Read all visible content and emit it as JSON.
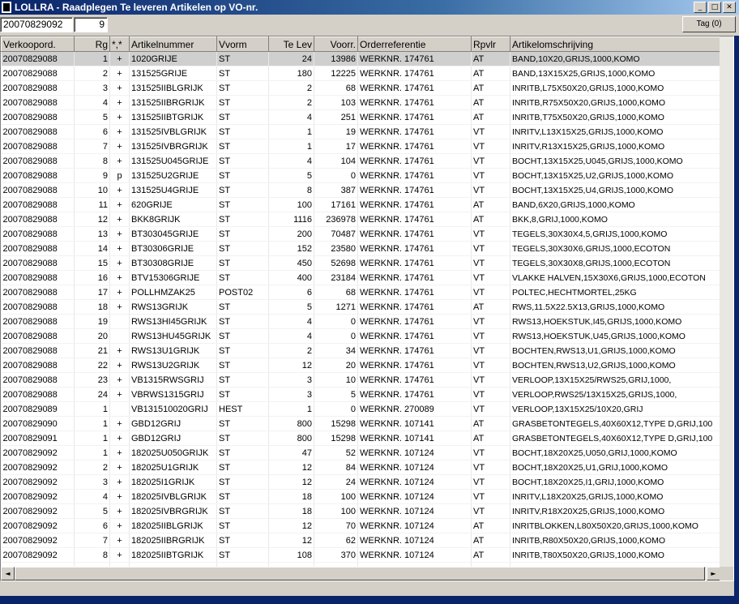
{
  "window": {
    "title": "LOLLRA - Raadplegen Te leveren Artikelen op VO-nr.",
    "minimize_glyph": "_",
    "maximize_glyph": "□",
    "close_glyph": "✕"
  },
  "toolbar": {
    "order_value": "20070829092",
    "count_value": "9",
    "tag_button_label": "Tag (0)"
  },
  "columns": [
    "Verkoopord.",
    "Rg",
    "*,*",
    "Artikelnummer",
    "Vvorm",
    "Te Lev",
    "Voorr.",
    "Orderreferentie",
    "Rpvlr",
    "Artikelomschrijving"
  ],
  "rows": [
    {
      "vo": "20070829088",
      "rg": "1",
      "flag": "+",
      "art": "1020GRIJE",
      "vvorm": "ST",
      "telev": "24",
      "voorr": "13986",
      "ref": "WERKNR. 174761",
      "rpvlr": "AT",
      "desc": "BAND,10X20,GRIJS,1000,KOMO",
      "selected": true
    },
    {
      "vo": "20070829088",
      "rg": "2",
      "flag": "+",
      "art": "131525GRIJE",
      "vvorm": "ST",
      "telev": "180",
      "voorr": "12225",
      "ref": "WERKNR. 174761",
      "rpvlr": "AT",
      "desc": "BAND,13X15X25,GRIJS,1000,KOMO"
    },
    {
      "vo": "20070829088",
      "rg": "3",
      "flag": "+",
      "art": "131525IIBLGRIJK",
      "vvorm": "ST",
      "telev": "2",
      "voorr": "68",
      "ref": "WERKNR. 174761",
      "rpvlr": "AT",
      "desc": "INRITB,L75X50X20,GRIJS,1000,KOMO"
    },
    {
      "vo": "20070829088",
      "rg": "4",
      "flag": "+",
      "art": "131525IIBRGRIJK",
      "vvorm": "ST",
      "telev": "2",
      "voorr": "103",
      "ref": "WERKNR. 174761",
      "rpvlr": "AT",
      "desc": "INRITB,R75X50X20,GRIJS,1000,KOMO"
    },
    {
      "vo": "20070829088",
      "rg": "5",
      "flag": "+",
      "art": "131525IIBTGRIJK",
      "vvorm": "ST",
      "telev": "4",
      "voorr": "251",
      "ref": "WERKNR. 174761",
      "rpvlr": "AT",
      "desc": "INRITB,T75X50X20,GRIJS,1000,KOMO"
    },
    {
      "vo": "20070829088",
      "rg": "6",
      "flag": "+",
      "art": "131525IVBLGRIJK",
      "vvorm": "ST",
      "telev": "1",
      "voorr": "19",
      "ref": "WERKNR. 174761",
      "rpvlr": "VT",
      "desc": "INRITV,L13X15X25,GRIJS,1000,KOMO"
    },
    {
      "vo": "20070829088",
      "rg": "7",
      "flag": "+",
      "art": "131525IVBRGRIJK",
      "vvorm": "ST",
      "telev": "1",
      "voorr": "17",
      "ref": "WERKNR. 174761",
      "rpvlr": "VT",
      "desc": "INRITV,R13X15X25,GRIJS,1000,KOMO"
    },
    {
      "vo": "20070829088",
      "rg": "8",
      "flag": "+",
      "art": "131525U045GRIJE",
      "vvorm": "ST",
      "telev": "4",
      "voorr": "104",
      "ref": "WERKNR. 174761",
      "rpvlr": "VT",
      "desc": "BOCHT,13X15X25,U045,GRIJS,1000,KOMO"
    },
    {
      "vo": "20070829088",
      "rg": "9",
      "flag": "p",
      "art": "131525U2GRIJE",
      "vvorm": "ST",
      "telev": "5",
      "voorr": "0",
      "ref": "WERKNR. 174761",
      "rpvlr": "VT",
      "desc": "BOCHT,13X15X25,U2,GRIJS,1000,KOMO"
    },
    {
      "vo": "20070829088",
      "rg": "10",
      "flag": "+",
      "art": "131525U4GRIJE",
      "vvorm": "ST",
      "telev": "8",
      "voorr": "387",
      "ref": "WERKNR. 174761",
      "rpvlr": "VT",
      "desc": "BOCHT,13X15X25,U4,GRIJS,1000,KOMO"
    },
    {
      "vo": "20070829088",
      "rg": "11",
      "flag": "+",
      "art": "620GRIJE",
      "vvorm": "ST",
      "telev": "100",
      "voorr": "17161",
      "ref": "WERKNR. 174761",
      "rpvlr": "AT",
      "desc": "BAND,6X20,GRIJS,1000,KOMO"
    },
    {
      "vo": "20070829088",
      "rg": "12",
      "flag": "+",
      "art": "BKK8GRIJK",
      "vvorm": "ST",
      "telev": "1116",
      "voorr": "236978",
      "ref": "WERKNR. 174761",
      "rpvlr": "AT",
      "desc": "BKK,8,GRIJ,1000,KOMO"
    },
    {
      "vo": "20070829088",
      "rg": "13",
      "flag": "+",
      "art": "BT303045GRIJE",
      "vvorm": "ST",
      "telev": "200",
      "voorr": "70487",
      "ref": "WERKNR. 174761",
      "rpvlr": "VT",
      "desc": "TEGELS,30X30X4,5,GRIJS,1000,KOMO"
    },
    {
      "vo": "20070829088",
      "rg": "14",
      "flag": "+",
      "art": "BT30306GRIJE",
      "vvorm": "ST",
      "telev": "152",
      "voorr": "23580",
      "ref": "WERKNR. 174761",
      "rpvlr": "VT",
      "desc": "TEGELS,30X30X6,GRIJS,1000,ECOTON"
    },
    {
      "vo": "20070829088",
      "rg": "15",
      "flag": "+",
      "art": "BT30308GRIJE",
      "vvorm": "ST",
      "telev": "450",
      "voorr": "52698",
      "ref": "WERKNR. 174761",
      "rpvlr": "VT",
      "desc": "TEGELS,30X30X8,GRIJS,1000,ECOTON"
    },
    {
      "vo": "20070829088",
      "rg": "16",
      "flag": "+",
      "art": "BTV15306GRIJE",
      "vvorm": "ST",
      "telev": "400",
      "voorr": "23184",
      "ref": "WERKNR. 174761",
      "rpvlr": "VT",
      "desc": "VLAKKE HALVEN,15X30X6,GRIJS,1000,ECOTON"
    },
    {
      "vo": "20070829088",
      "rg": "17",
      "flag": "+",
      "art": "POLLHMZAK25",
      "vvorm": "POST02",
      "telev": "6",
      "voorr": "68",
      "ref": "WERKNR. 174761",
      "rpvlr": "VT",
      "desc": "POLTEC,HECHTMORTEL,25KG"
    },
    {
      "vo": "20070829088",
      "rg": "18",
      "flag": "+",
      "art": "RWS13GRIJK",
      "vvorm": "ST",
      "telev": "5",
      "voorr": "1271",
      "ref": "WERKNR. 174761",
      "rpvlr": "AT",
      "desc": "RWS,11.5X22.5X13,GRIJS,1000,KOMO"
    },
    {
      "vo": "20070829088",
      "rg": "19",
      "flag": "",
      "art": "RWS13HI45GRIJK",
      "vvorm": "ST",
      "telev": "4",
      "voorr": "0",
      "ref": "WERKNR. 174761",
      "rpvlr": "VT",
      "desc": "RWS13,HOEKSTUK,I45,GRIJS,1000,KOMO"
    },
    {
      "vo": "20070829088",
      "rg": "20",
      "flag": "",
      "art": "RWS13HU45GRIJK",
      "vvorm": "ST",
      "telev": "4",
      "voorr": "0",
      "ref": "WERKNR. 174761",
      "rpvlr": "VT",
      "desc": "RWS13,HOEKSTUK,U45,GRIJS,1000,KOMO"
    },
    {
      "vo": "20070829088",
      "rg": "21",
      "flag": "+",
      "art": "RWS13U1GRIJK",
      "vvorm": "ST",
      "telev": "2",
      "voorr": "34",
      "ref": "WERKNR. 174761",
      "rpvlr": "VT",
      "desc": "BOCHTEN,RWS13,U1,GRIJS,1000,KOMO"
    },
    {
      "vo": "20070829088",
      "rg": "22",
      "flag": "+",
      "art": "RWS13U2GRIJK",
      "vvorm": "ST",
      "telev": "12",
      "voorr": "20",
      "ref": "WERKNR. 174761",
      "rpvlr": "VT",
      "desc": "BOCHTEN,RWS13,U2,GRIJS,1000,KOMO"
    },
    {
      "vo": "20070829088",
      "rg": "23",
      "flag": "+",
      "art": "VB1315RWSGRIJ",
      "vvorm": "ST",
      "telev": "3",
      "voorr": "10",
      "ref": "WERKNR. 174761",
      "rpvlr": "VT",
      "desc": "VERLOOP,13X15X25/RWS25,GRIJ,1000,"
    },
    {
      "vo": "20070829088",
      "rg": "24",
      "flag": "+",
      "art": "VBRWS1315GRIJ",
      "vvorm": "ST",
      "telev": "3",
      "voorr": "5",
      "ref": "WERKNR. 174761",
      "rpvlr": "VT",
      "desc": "VERLOOP,RWS25/13X15X25,GRIJS,1000,"
    },
    {
      "vo": "20070829089",
      "rg": "1",
      "flag": "",
      "art": "VB131510020GRIJ",
      "vvorm": "HEST",
      "telev": "1",
      "voorr": "0",
      "ref": "WERKNR. 270089",
      "rpvlr": "VT",
      "desc": "VERLOOP,13X15X25/10X20,GRIJ"
    },
    {
      "vo": "20070829090",
      "rg": "1",
      "flag": "+",
      "art": "GBD12GRIJ",
      "vvorm": "ST",
      "telev": "800",
      "voorr": "15298",
      "ref": "WERKNR. 107141",
      "rpvlr": "AT",
      "desc": "GRASBETONTEGELS,40X60X12,TYPE D,GRIJ,100"
    },
    {
      "vo": "20070829091",
      "rg": "1",
      "flag": "+",
      "art": "GBD12GRIJ",
      "vvorm": "ST",
      "telev": "800",
      "voorr": "15298",
      "ref": "WERKNR. 107141",
      "rpvlr": "AT",
      "desc": "GRASBETONTEGELS,40X60X12,TYPE D,GRIJ,100"
    },
    {
      "vo": "20070829092",
      "rg": "1",
      "flag": "+",
      "art": "182025U050GRIJK",
      "vvorm": "ST",
      "telev": "47",
      "voorr": "52",
      "ref": "WERKNR. 107124",
      "rpvlr": "VT",
      "desc": "BOCHT,18X20X25,U050,GRIJ,1000,KOMO"
    },
    {
      "vo": "20070829092",
      "rg": "2",
      "flag": "+",
      "art": "182025U1GRIJK",
      "vvorm": "ST",
      "telev": "12",
      "voorr": "84",
      "ref": "WERKNR. 107124",
      "rpvlr": "VT",
      "desc": "BOCHT,18X20X25,U1,GRIJ,1000,KOMO"
    },
    {
      "vo": "20070829092",
      "rg": "3",
      "flag": "+",
      "art": "182025I1GRIJK",
      "vvorm": "ST",
      "telev": "12",
      "voorr": "24",
      "ref": "WERKNR. 107124",
      "rpvlr": "VT",
      "desc": "BOCHT,18X20X25,I1,GRIJ,1000,KOMO"
    },
    {
      "vo": "20070829092",
      "rg": "4",
      "flag": "+",
      "art": "182025IVBLGRIJK",
      "vvorm": "ST",
      "telev": "18",
      "voorr": "100",
      "ref": "WERKNR. 107124",
      "rpvlr": "VT",
      "desc": "INRITV,L18X20X25,GRIJS,1000,KOMO"
    },
    {
      "vo": "20070829092",
      "rg": "5",
      "flag": "+",
      "art": "182025IVBRGRIJK",
      "vvorm": "ST",
      "telev": "18",
      "voorr": "100",
      "ref": "WERKNR. 107124",
      "rpvlr": "VT",
      "desc": "INRITV,R18X20X25,GRIJS,1000,KOMO"
    },
    {
      "vo": "20070829092",
      "rg": "6",
      "flag": "+",
      "art": "182025IIBLGRIJK",
      "vvorm": "ST",
      "telev": "12",
      "voorr": "70",
      "ref": "WERKNR. 107124",
      "rpvlr": "AT",
      "desc": "INRITBLOKKEN,L80X50X20,GRIJS,1000,KOMO"
    },
    {
      "vo": "20070829092",
      "rg": "7",
      "flag": "+",
      "art": "182025IIBRGRIJK",
      "vvorm": "ST",
      "telev": "12",
      "voorr": "62",
      "ref": "WERKNR. 107124",
      "rpvlr": "AT",
      "desc": "INRITB,R80X50X20,GRIJS,1000,KOMO"
    },
    {
      "vo": "20070829092",
      "rg": "8",
      "flag": "+",
      "art": "182025IIBTGRIJK",
      "vvorm": "ST",
      "telev": "108",
      "voorr": "370",
      "ref": "WERKNR. 107124",
      "rpvlr": "AT",
      "desc": "INRITB,T80X50X20,GRIJS,1000,KOMO"
    }
  ],
  "scroll": {
    "left_arrow": "◄",
    "right_arrow": "►",
    "up_arrow": "▲",
    "down_arrow": "▼"
  }
}
